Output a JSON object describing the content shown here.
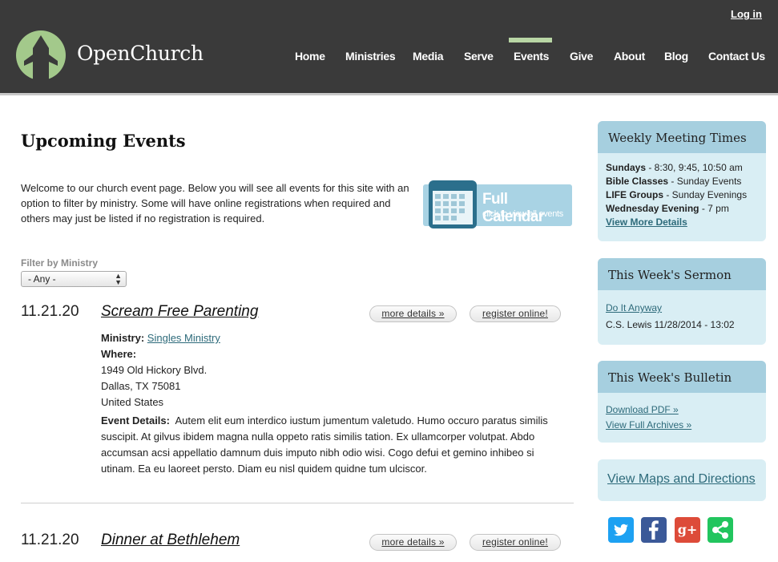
{
  "header": {
    "brand": "OpenChurch",
    "login_label": "Log in",
    "nav": [
      {
        "label": "Home"
      },
      {
        "label": "Ministries"
      },
      {
        "label": "Media"
      },
      {
        "label": "Serve"
      },
      {
        "label": "Events",
        "active": true
      },
      {
        "label": "Give"
      },
      {
        "label": "About"
      },
      {
        "label": "Blog"
      },
      {
        "label": "Contact Us"
      }
    ],
    "colors": {
      "background": "#3a3a3a",
      "accent": "#b9d6a5"
    }
  },
  "main": {
    "title": "Upcoming Events",
    "intro": "Welcome to our church event page. Below you will see all events for this site with an option to filter by ministry. Some will have online registrations when required and others may just be listed if no registration is required.",
    "full_calendar": {
      "title": "Full Calendar",
      "subtitle": "click to view all events",
      "icon": "calendar-icon"
    },
    "filter": {
      "label": "Filter by Ministry",
      "selected": "- Any -"
    },
    "events": [
      {
        "date": "11.21.20",
        "title": "Scream Free Parenting",
        "more_label": "more details »",
        "register_label": "register online!",
        "ministry_label": "Ministry:",
        "ministry_value": "Singles Ministry",
        "where_label": "Where:",
        "address_line1": "1949 Old Hickory Blvd.",
        "address_line2": "Dallas, TX 75081",
        "address_line3": "United States",
        "details_label": "Event Details:",
        "details": "Autem elit eum interdico iustum jumentum valetudo. Humo occuro paratus similis suscipit. At gilvus ibidem magna nulla oppeto ratis similis tation. Ex ullamcorper volutpat. Abdo accumsan acsi appellatio damnum duis imputo nibh odio wisi. Cogo defui et gemino inhibeo si utinam. Ea eu laoreet persto. Diam eu nisl quidem quidne tum ulciscor."
      },
      {
        "date": "11.21.20",
        "title": "Dinner at Bethlehem",
        "more_label": "more details »",
        "register_label": "register online!"
      }
    ]
  },
  "sidebar": {
    "meeting": {
      "title": "Weekly Meeting Times",
      "rows": [
        {
          "label": "Sundays",
          "value": " - 8:30, 9:45, 10:50 am"
        },
        {
          "label": "Bible Classes",
          "value": " - Sunday Events"
        },
        {
          "label": "LIFE Groups",
          "value": " - Sunday Evenings"
        },
        {
          "label": "Wednesday Evening",
          "value": " - 7 pm"
        }
      ],
      "link": "View More Details"
    },
    "sermon": {
      "title": "This Week's Sermon",
      "link": "Do It Anyway",
      "meta": "C.S. Lewis 11/28/2014 - 13:02"
    },
    "bulletin": {
      "title": "This Week's Bulletin",
      "download": "Download PDF »",
      "archives": "View Full Archives »"
    },
    "maps_link": "View Maps and Directions",
    "social": [
      {
        "icon": "twitter-icon",
        "color": "#1da1f2"
      },
      {
        "icon": "facebook-icon",
        "color": "#3b5998"
      },
      {
        "icon": "google-plus-icon",
        "color": "#dd4b39"
      },
      {
        "icon": "share-icon",
        "color": "#22c55e"
      }
    ]
  }
}
